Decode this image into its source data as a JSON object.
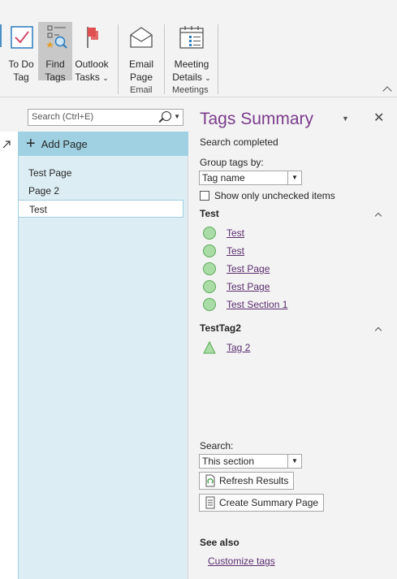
{
  "ribbon": {
    "buttons": [
      {
        "line1": "To Do",
        "line2": "Tag",
        "icon": "checkbox-icon"
      },
      {
        "line1": "Find",
        "line2": "Tags",
        "icon": "find-tags-icon"
      },
      {
        "line1": "Outlook",
        "line2": "Tasks",
        "icon": "flag-icon"
      },
      {
        "line1": "Email",
        "line2": "Page",
        "icon": "envelope-icon"
      },
      {
        "line1": "Meeting",
        "line2": "Details",
        "icon": "calendar-icon"
      }
    ],
    "groups": {
      "email": "Email",
      "meetings": "Meetings"
    }
  },
  "search": {
    "placeholder": "Search (Ctrl+E)"
  },
  "page_list": {
    "add_page": "Add Page",
    "pages": [
      "Test Page",
      "Page 2",
      "Test"
    ]
  },
  "tags_summary": {
    "title": "Tags Summary",
    "status": "Search completed",
    "group_by_label": "Group tags by:",
    "group_by_value": "Tag name",
    "unchecked_label": "Show only unchecked items",
    "groups": [
      {
        "name": "Test",
        "items": [
          "Test",
          "Test",
          "Test Page",
          "Test Page",
          "Test Section 1"
        ],
        "shape": "circle"
      },
      {
        "name": "TestTag2",
        "items": [
          "Tag 2"
        ],
        "shape": "triangle"
      }
    ],
    "search_label": "Search:",
    "search_scope": "This section",
    "refresh_button": "Refresh Results",
    "create_summary_button": "Create Summary Page",
    "see_also": "See also",
    "customize_link": "Customize tags"
  },
  "colors": {
    "accent_purple": "#7b3b8c",
    "page_pane": "#dcedf4",
    "add_page_bar": "#9fd1e3",
    "tag_green": "#a9dca6"
  }
}
